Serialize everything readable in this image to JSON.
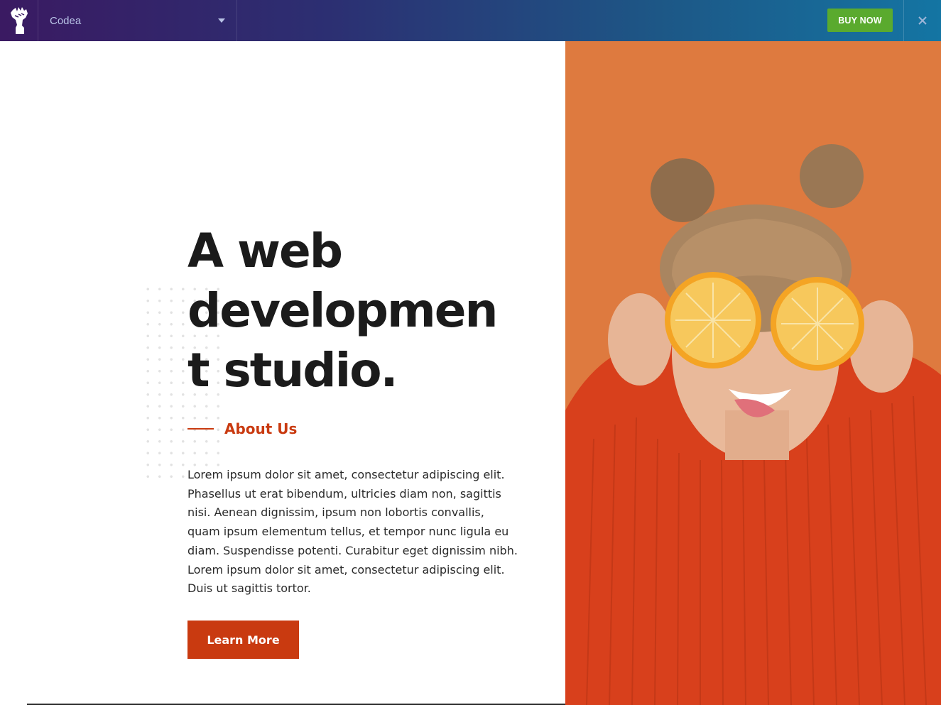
{
  "topbar": {
    "theme_name": "Codea",
    "buy_label": "BUY NOW",
    "logo_icon": "raised-fist-icon",
    "close_icon": "close-icon",
    "dropdown_icon": "caret-down-icon"
  },
  "hero": {
    "title_lines": [
      "A web",
      "developmen",
      "t studio."
    ],
    "section_label": "About Us",
    "body": "Lorem ipsum dolor sit amet, consectetur adipiscing elit. Phasellus ut erat bibendum, ultricies diam non, sagittis nisi. Aenean dignissim, ipsum non lobortis convallis, quam ipsum elementum tellus, et tempor nunc ligula eu diam. Suspendisse potenti. Curabitur eget dignissim nibh. Lorem ipsum dolor sit amet, consectetur adipiscing elit. Duis ut sagittis tortor.",
    "cta_label": "Learn More"
  },
  "colors": {
    "accent": "#c93a10",
    "buy_button": "#5aaa2e",
    "topbar_start": "#3a1a62",
    "topbar_end": "#1475a3",
    "photo_background": "#de7a3f",
    "sweater": "#d8401c"
  },
  "photo": {
    "subject": "woman-holding-orange-halves-over-eyes"
  }
}
